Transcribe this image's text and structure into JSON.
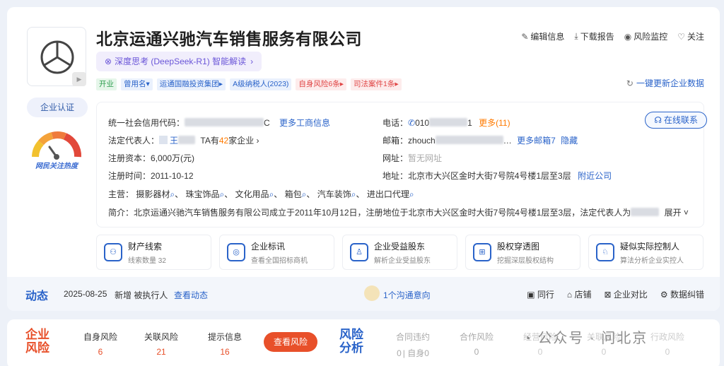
{
  "company": {
    "name": "北京运通兴驰汽车销售服务有限公司",
    "ai_insight": "深度思考 (DeepSeek-R1) 智能解读",
    "tags": [
      {
        "label": "开业",
        "color": "green"
      },
      {
        "label": "曾用名",
        "color": "blue"
      },
      {
        "label": "运通国融投资集团",
        "color": "blue"
      },
      {
        "label": "A级纳税人(2023)",
        "color": "blue"
      },
      {
        "label": "自身风险6条",
        "color": "red"
      },
      {
        "label": "司法案件1条",
        "color": "red"
      }
    ],
    "verify_label": "企业认证",
    "heat_label": "网民关注热度"
  },
  "actions": {
    "edit": "编辑信息",
    "download": "下载报告",
    "monitor": "风险监控",
    "follow": "关注",
    "refresh": "一键更新企业数据"
  },
  "info": {
    "credit_code_label": "统一社会信用代码：",
    "credit_code_suffix": "C",
    "more_business": "更多工商信息",
    "legal_rep_label": "法定代表人：",
    "legal_rep_prefix": "王",
    "legal_rep_ta": "TA有",
    "legal_rep_count": "42",
    "legal_rep_suffix": "家企业",
    "capital_label": "注册资本：",
    "capital_value": "6,000万(元)",
    "reg_time_label": "注册时间：",
    "reg_time_value": "2011-10-12",
    "business_label": "主营：",
    "business_items": [
      "摄影器材",
      "珠宝饰品",
      "文化用品",
      "箱包",
      "汽车装饰",
      "进出口代理"
    ],
    "intro_label": "简介：",
    "intro_text": "北京运通兴驰汽车销售服务有限公司成立于2011年10月12日，注册地位于北京市大兴区金时大街7号院4号楼1层至3层，法定代表人为",
    "expand": "展开",
    "phone_label": "电话：",
    "phone_prefix": "010",
    "phone_suffix": "1",
    "phone_more": "更多(11)",
    "email_label": "邮箱：",
    "email_prefix": "zhouch",
    "email_more": "更多邮箱7",
    "email_hide": "隐藏",
    "website_label": "网址：",
    "website_value": "暂无网址",
    "address_label": "地址：",
    "address_value": "北京市大兴区金时大街7号院4号楼1层至3层",
    "nearby": "附近公司",
    "online_contact": "在线联系"
  },
  "features": [
    {
      "title": "财产线索",
      "sub": "线索数量 32",
      "icon": "property-icon"
    },
    {
      "title": "企业标讯",
      "sub": "查看全国招标商机",
      "icon": "bid-icon"
    },
    {
      "title": "企业受益股东",
      "sub": "解析企业受益股东",
      "icon": "shareholder-icon"
    },
    {
      "title": "股权穿透图",
      "sub": "挖掘深层股权结构",
      "icon": "equity-icon"
    },
    {
      "title": "疑似实际控制人",
      "sub": "算法分析企业实控人",
      "icon": "controller-icon"
    }
  ],
  "dynamics": {
    "title": "动态",
    "date": "2025-08-25",
    "text": "新增 被执行人",
    "link": "查看动态",
    "chat": "1个沟通意向",
    "acts": [
      "同行",
      "店铺",
      "企业对比",
      "数据纠错"
    ]
  },
  "risk": {
    "title_line1": "企业",
    "title_line2": "风险",
    "stats": [
      {
        "label": "自身风险",
        "value": "6"
      },
      {
        "label": "关联风险",
        "value": "21"
      },
      {
        "label": "提示信息",
        "value": "16"
      }
    ],
    "button": "查看风险",
    "analysis_line1": "风险",
    "analysis_line2": "分析",
    "analysis": [
      {
        "label": "合同违约",
        "value": "0",
        "extra": "自身0"
      },
      {
        "label": "合作风险",
        "value": "0"
      },
      {
        "label": "经营风险",
        "value": "0"
      },
      {
        "label": "关联风险",
        "value": "0"
      },
      {
        "label": "行政风险",
        "value": "0"
      }
    ]
  },
  "watermark": "公众号 · 问北京"
}
